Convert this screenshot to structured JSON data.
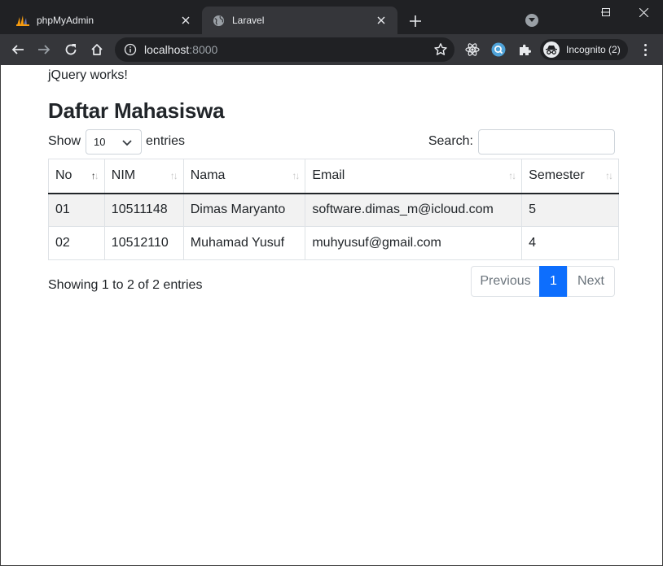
{
  "browser": {
    "tabs": [
      {
        "title": "phpMyAdmin",
        "active": false
      },
      {
        "title": "Laravel",
        "active": true
      }
    ],
    "url_host": "localhost",
    "url_port": ":8000",
    "profile_label": "Incognito (2)"
  },
  "page": {
    "jquery_message": "jQuery works!",
    "heading": "Daftar Mahasiswa",
    "length_prefix": "Show",
    "length_value": "10",
    "length_suffix": "entries",
    "search_label": "Search:",
    "search_value": "",
    "columns": [
      "No",
      "NIM",
      "Nama",
      "Email",
      "Semester"
    ],
    "rows": [
      [
        "01",
        "10511148",
        "Dimas Maryanto",
        "software.dimas_m@icloud.com",
        "5"
      ],
      [
        "02",
        "10512110",
        "Muhamad Yusuf",
        "muhyusuf@gmail.com",
        "4"
      ]
    ],
    "info": "Showing 1 to 2 of 2 entries",
    "pagination": {
      "previous": "Previous",
      "current": "1",
      "next": "Next"
    }
  },
  "colors": {
    "titlebar": "#202124",
    "toolbar": "#35363a",
    "accent": "#0d6efd"
  },
  "icons": [
    "phpmyadmin-icon",
    "globe-icon",
    "close-icon",
    "plus-icon",
    "tab-search-icon",
    "minimize-icon",
    "maximize-icon",
    "window-close-icon",
    "back-icon",
    "forward-icon",
    "reload-icon",
    "home-icon",
    "info-icon",
    "star-icon",
    "react-icon",
    "extension-search-icon",
    "puzzle-icon",
    "incognito-icon",
    "kebab-menu-icon",
    "chevron-down-icon",
    "sort-icon"
  ]
}
